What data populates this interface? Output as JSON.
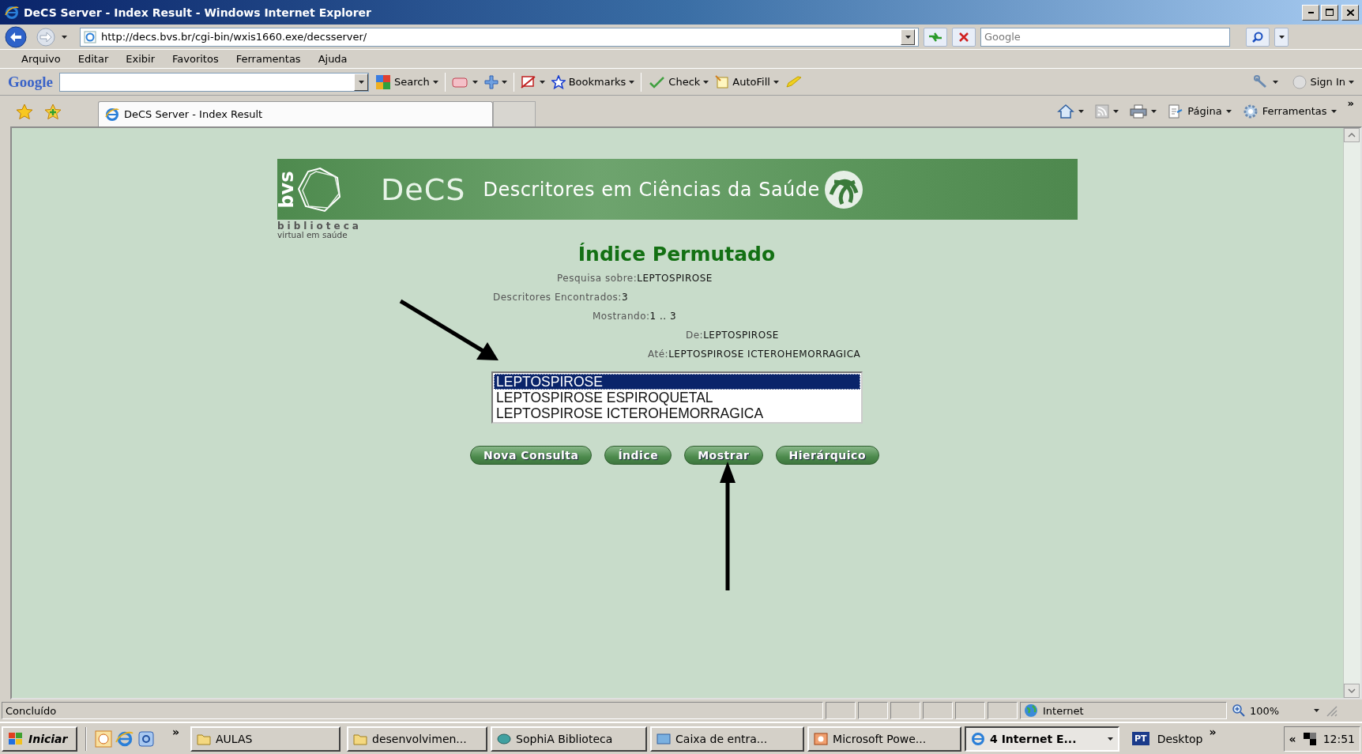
{
  "window": {
    "title": "DeCS Server - Index Result - Windows Internet Explorer"
  },
  "address_bar": {
    "url": "http://decs.bvs.br/cgi-bin/wxis1660.exe/decsserver/",
    "search_placeholder": "Google"
  },
  "menu": [
    "Arquivo",
    "Editar",
    "Exibir",
    "Favoritos",
    "Ferramentas",
    "Ajuda"
  ],
  "google_toolbar": {
    "logo": "Google",
    "search_label": "Search",
    "bookmarks": "Bookmarks",
    "check": "Check",
    "autofill": "AutoFill",
    "sign_in": "Sign In"
  },
  "tabs": [
    {
      "label": "DeCS Server - Index Result",
      "selected": true
    }
  ],
  "command_bar": {
    "page": "Página",
    "tools": "Ferramentas",
    "more": "»"
  },
  "page": {
    "banner": {
      "logo": "bvs",
      "title": "DeCS",
      "subtitle": "Descritores em Ciências da Saúde",
      "caption_1": "biblioteca",
      "caption_2": "virtual em saúde"
    },
    "heading": "Índice Permutado",
    "info": [
      {
        "label": "Pesquisa sobre:",
        "value": "LEPTOSPIROSE"
      },
      {
        "label": "Descritores Encontrados:",
        "value": "3"
      },
      {
        "label": "Mostrando:",
        "value": "1 .. 3"
      },
      {
        "label": "De:",
        "value": "LEPTOSPIROSE"
      },
      {
        "label": "Até:",
        "value": "LEPTOSPIROSE ICTEROHEMORRAGICA"
      }
    ],
    "list": [
      {
        "label": "LEPTOSPIROSE",
        "selected": true
      },
      {
        "label": "LEPTOSPIROSE ESPIROQUETAL",
        "selected": false
      },
      {
        "label": "LEPTOSPIROSE ICTEROHEMORRAGICA",
        "selected": false
      }
    ],
    "buttons": [
      "Nova Consulta",
      "Índice",
      "Mostrar",
      "Hierárquico"
    ]
  },
  "status_bar": {
    "text": "Concluído",
    "zone": "Internet",
    "zoom": "100%"
  },
  "taskbar": {
    "start": "Iniciar",
    "more": "»",
    "items": [
      {
        "kind": "folder",
        "label": "AULAS",
        "selected": false
      },
      {
        "kind": "folder",
        "label": "desenvolvimen...",
        "selected": false
      },
      {
        "kind": "book",
        "label": "SophiA Biblioteca",
        "selected": false
      },
      {
        "kind": "mail",
        "label": "Caixa de entra...",
        "selected": false
      },
      {
        "kind": "slides",
        "label": "Microsoft Powe...",
        "selected": false
      },
      {
        "kind": "browser",
        "label": "4 Internet E...",
        "selected": true
      }
    ],
    "language": "PT",
    "desktop": "Desktop",
    "more_right": "»",
    "tray_toggle": "«",
    "clock": "12:51"
  }
}
